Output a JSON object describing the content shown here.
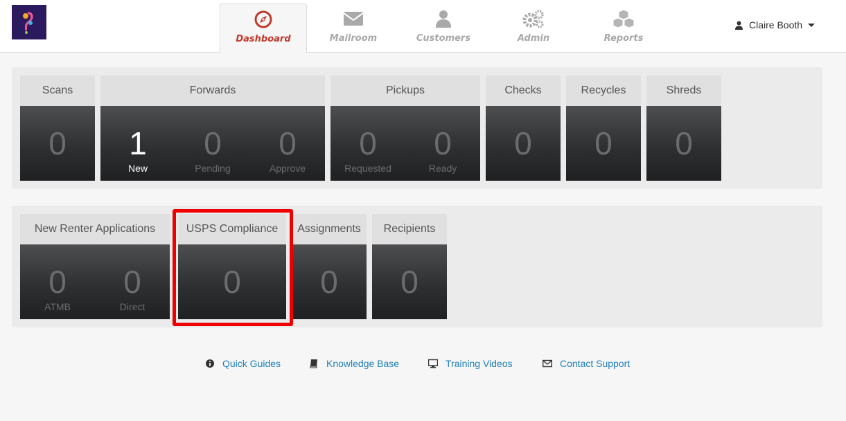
{
  "nav": {
    "tabs": [
      {
        "label": "Dashboard",
        "icon": "compass-icon",
        "active": true
      },
      {
        "label": "Mailroom",
        "icon": "envelope-icon",
        "active": false
      },
      {
        "label": "Customers",
        "icon": "user-icon",
        "active": false
      },
      {
        "label": "Admin",
        "icon": "gears-icon",
        "active": false
      },
      {
        "label": "Reports",
        "icon": "cubes-icon",
        "active": false
      }
    ],
    "user_name": "Claire Booth"
  },
  "row1": {
    "scans": {
      "title": "Scans",
      "value": "0"
    },
    "forwards": {
      "title": "Forwards",
      "new_value": "1",
      "new_label": "New",
      "pending_value": "0",
      "pending_label": "Pending",
      "approve_value": "0",
      "approve_label": "Approve"
    },
    "pickups": {
      "title": "Pickups",
      "requested_value": "0",
      "requested_label": "Requested",
      "ready_value": "0",
      "ready_label": "Ready"
    },
    "checks": {
      "title": "Checks",
      "value": "0"
    },
    "recycles": {
      "title": "Recycles",
      "value": "0"
    },
    "shreds": {
      "title": "Shreds",
      "value": "0"
    }
  },
  "row2": {
    "new_renter": {
      "title": "New Renter Applications",
      "atmb_value": "0",
      "atmb_label": "ATMB",
      "direct_value": "0",
      "direct_label": "Direct"
    },
    "usps": {
      "title": "USPS Compliance",
      "value": "0"
    },
    "assignments": {
      "title": "Assignments",
      "value": "0"
    },
    "recipients": {
      "title": "Recipients",
      "value": "0"
    }
  },
  "footer": {
    "links": [
      {
        "label": "Quick Guides",
        "icon": "info-circle-icon"
      },
      {
        "label": "Knowledge Base",
        "icon": "book-icon"
      },
      {
        "label": "Training Videos",
        "icon": "desktop-icon"
      },
      {
        "label": "Contact Support",
        "icon": "envelope-outline-icon"
      }
    ]
  },
  "colors": {
    "accent": "#c0392b",
    "highlight": "#ee0000",
    "link": "#1f7fb8",
    "tile_dark": "#2f3032"
  }
}
